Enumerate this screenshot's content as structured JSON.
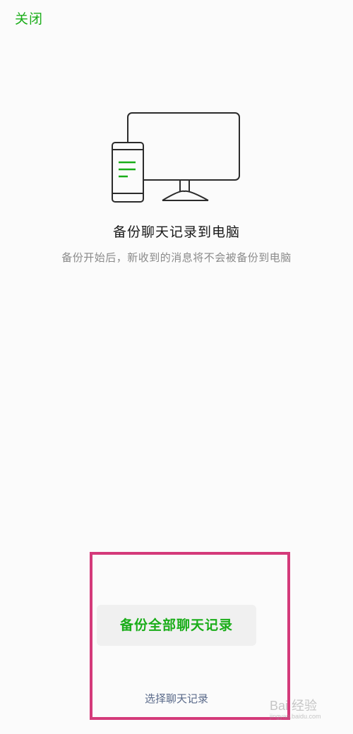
{
  "header": {
    "close_label": "关闭"
  },
  "main": {
    "title": "备份聊天记录到电脑",
    "subtitle": "备份开始后，新收到的消息将不会被备份到电脑"
  },
  "actions": {
    "backup_all_label": "备份全部聊天记录",
    "select_label": "选择聊天记录"
  },
  "watermark": {
    "text": "Bai 经验",
    "sub": "jingyan.baidu.com"
  },
  "colors": {
    "accent_green": "#1aad19",
    "highlight_pink": "#d43a7a",
    "link_blue_grey": "#5a6a8a"
  },
  "icons": {
    "illustration": "phone-and-monitor-icon"
  }
}
